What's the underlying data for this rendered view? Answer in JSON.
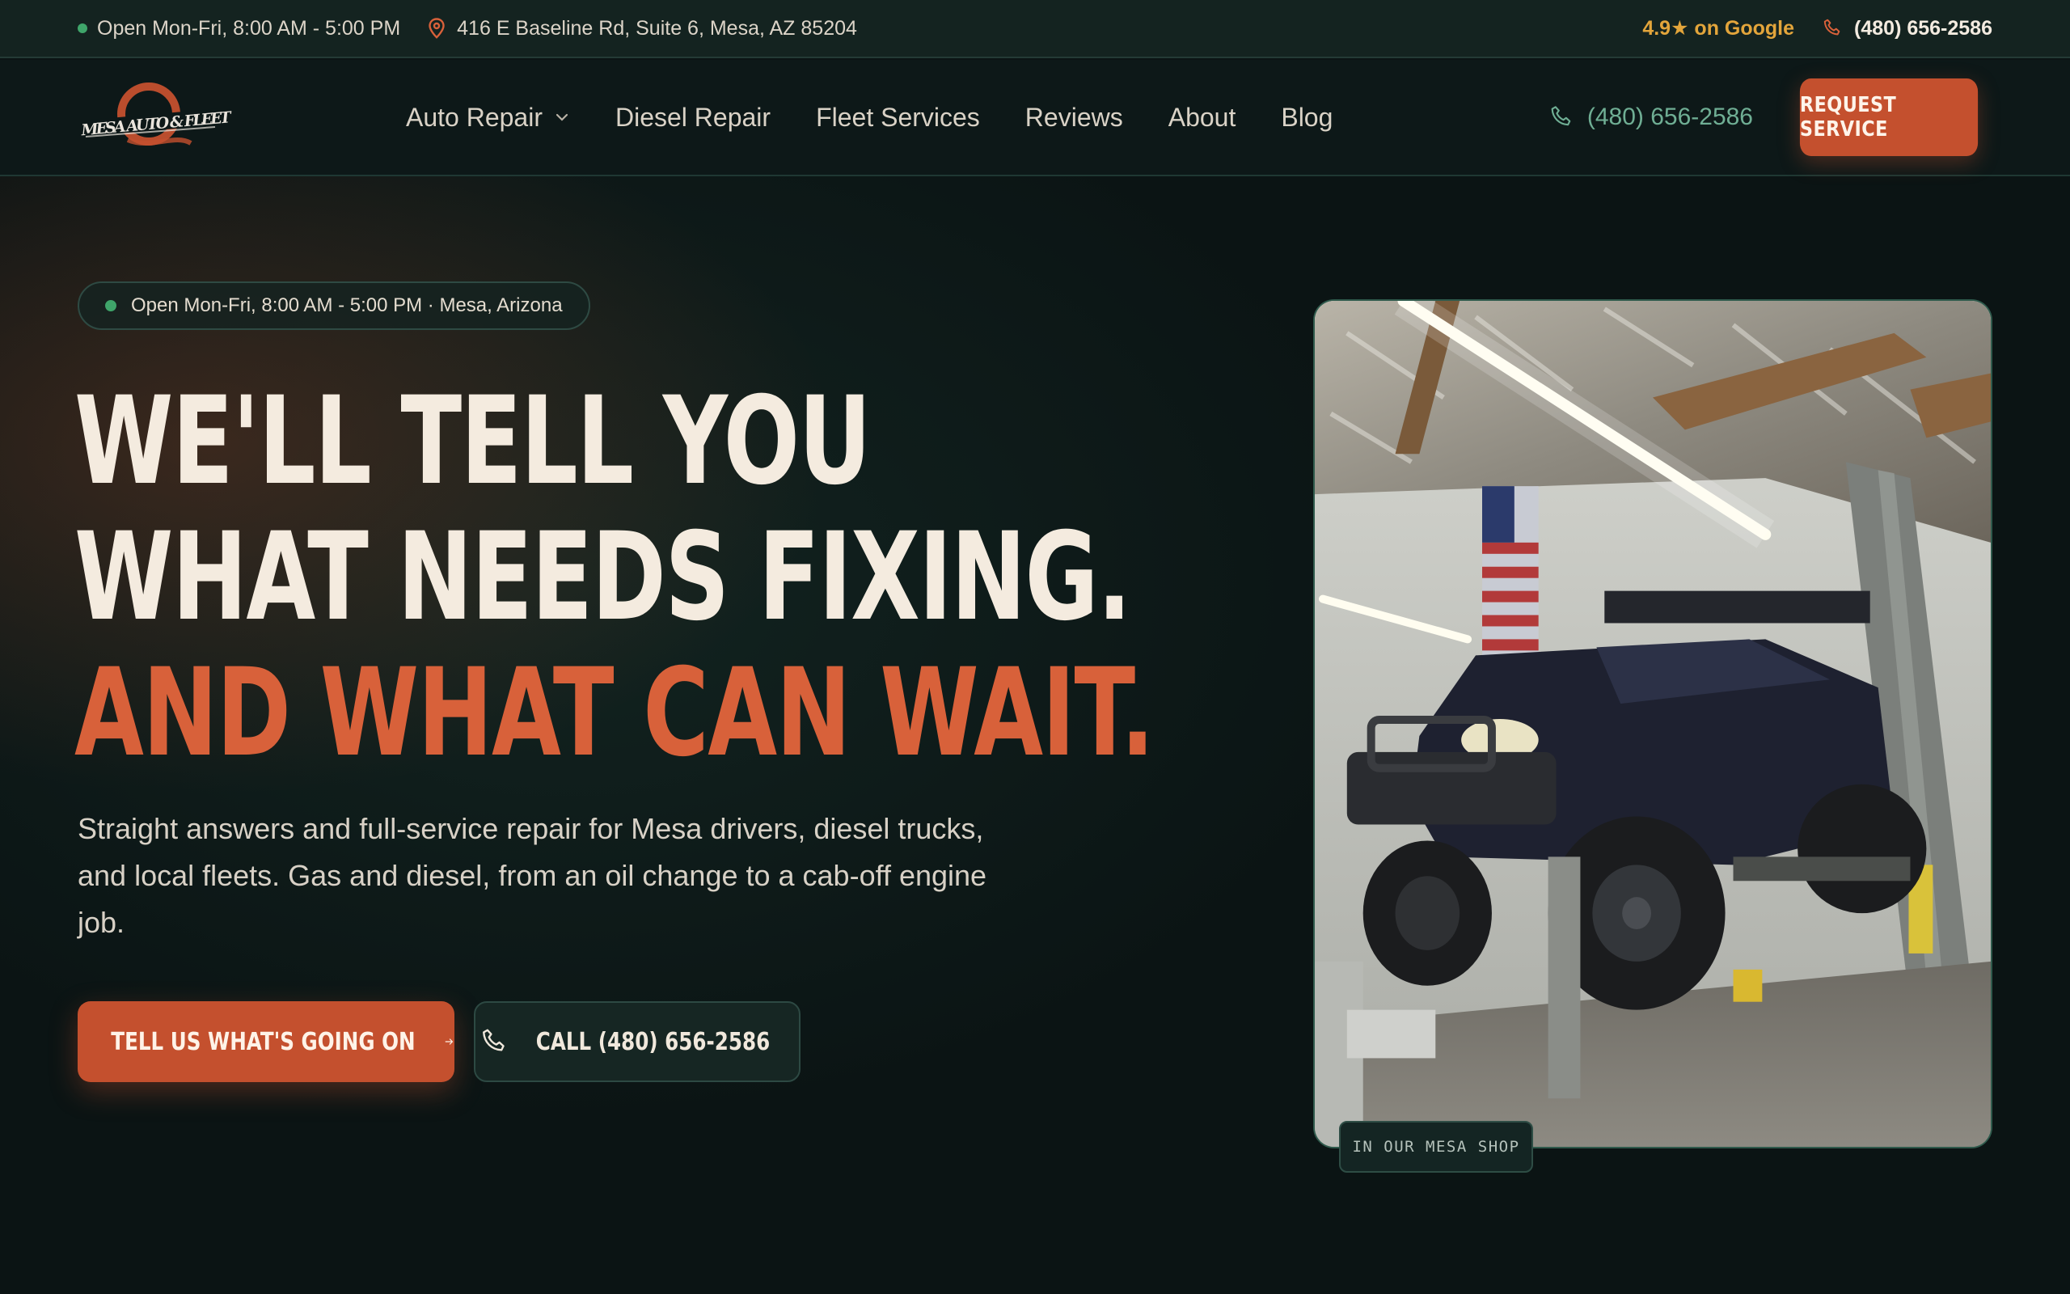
{
  "topbar": {
    "hours": "Open Mon-Fri, 8:00 AM - 5:00 PM",
    "address": "416 E Baseline Rd, Suite 6, Mesa, AZ 85204",
    "rating": "4.9★ on Google",
    "phone": "(480) 656-2586"
  },
  "brand": {
    "logo_text": "MESA AUTO & FLEET",
    "accent_color": "#c4502e",
    "status_color": "#3fa56a"
  },
  "nav": {
    "items": [
      {
        "label": "Auto Repair",
        "has_dropdown": true
      },
      {
        "label": "Diesel Repair"
      },
      {
        "label": "Fleet Services"
      },
      {
        "label": "Reviews"
      },
      {
        "label": "About"
      },
      {
        "label": "Blog"
      }
    ],
    "phone": "(480) 656-2586",
    "cta": "REQUEST SERVICE"
  },
  "hero": {
    "pill": "Open Mon-Fri, 8:00 AM - 5:00 PM · Mesa, Arizona",
    "headline_1": "WE'LL TELL YOU",
    "headline_2": "WHAT NEEDS FIXING.",
    "headline_3": "AND WHAT CAN WAIT.",
    "subtext": "Straight answers and full-service repair for Mesa drivers, diesel trucks, and local fleets. Gas and diesel, from an oil change to a cab-off engine job.",
    "primary_cta": "TELL US WHAT'S GOING ON",
    "secondary_cta": "CALL (480) 656-2586",
    "photo_caption": "IN OUR MESA SHOP"
  }
}
